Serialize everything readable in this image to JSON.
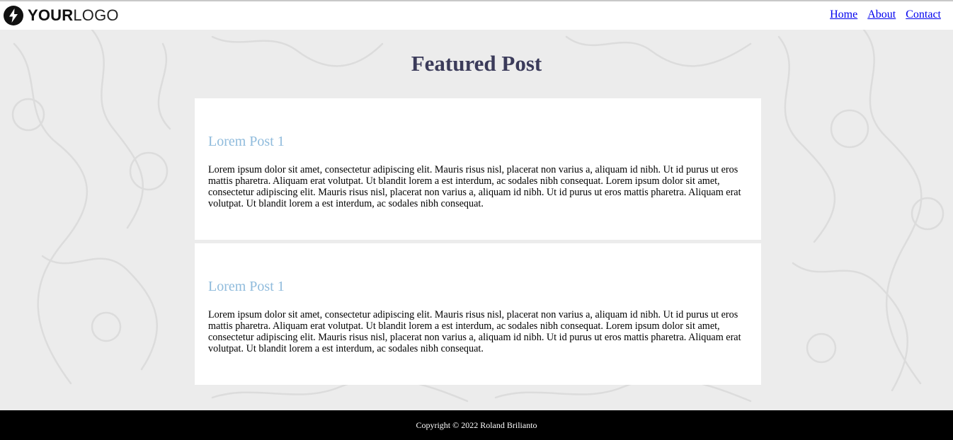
{
  "header": {
    "logo": {
      "bold_text": "YOUR",
      "light_text": "LOGO",
      "icon": "lightning-bolt-icon"
    },
    "nav": [
      {
        "label": "Home"
      },
      {
        "label": "About"
      },
      {
        "label": "Contact"
      }
    ]
  },
  "main": {
    "title": "Featured Post",
    "posts": [
      {
        "title": "Lorem Post 1",
        "body": "Lorem ipsum dolor sit amet, consectetur adipiscing elit. Mauris risus nisl, placerat non varius a, aliquam id nibh. Ut id purus ut eros mattis pharetra. Aliquam erat volutpat. Ut blandit lorem a est interdum, ac sodales nibh consequat. Lorem ipsum dolor sit amet, consectetur adipiscing elit. Mauris risus nisl, placerat non varius a, aliquam id nibh. Ut id purus ut eros mattis pharetra. Aliquam erat volutpat. Ut blandit lorem a est interdum, ac sodales nibh consequat."
      },
      {
        "title": "Lorem Post 1",
        "body": "Lorem ipsum dolor sit amet, consectetur adipiscing elit. Mauris risus nisl, placerat non varius a, aliquam id nibh. Ut id purus ut eros mattis pharetra. Aliquam erat volutpat. Ut blandit lorem a est interdum, ac sodales nibh consequat. Lorem ipsum dolor sit amet, consectetur adipiscing elit. Mauris risus nisl, placerat non varius a, aliquam id nibh. Ut id purus ut eros mattis pharetra. Aliquam erat volutpat. Ut blandit lorem a est interdum, ac sodales nibh consequat."
      }
    ]
  },
  "footer": {
    "copyright": "Copyright © 2022 Roland Brilianto"
  },
  "colors": {
    "background": "#ececec",
    "title": "#3b3b5a",
    "post_title": "#8fbbdc",
    "link": "#0000ee",
    "footer_bg": "#000000"
  }
}
